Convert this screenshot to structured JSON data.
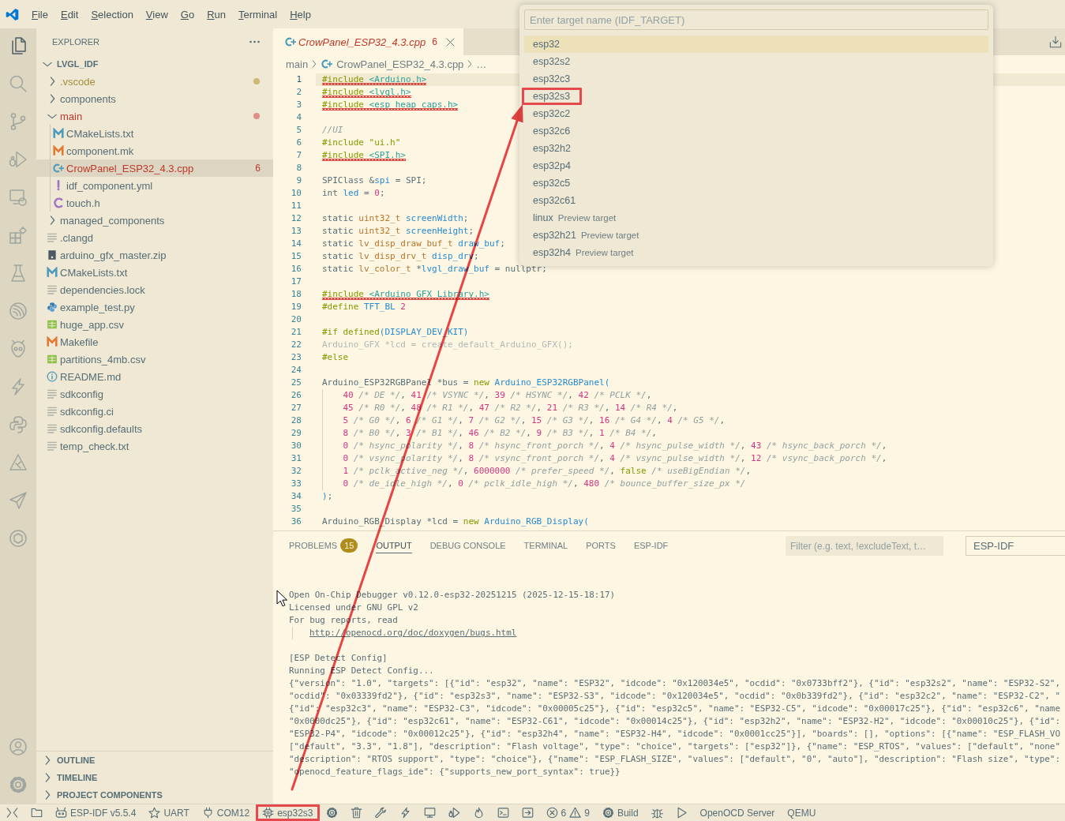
{
  "menu": [
    "File",
    "Edit",
    "Selection",
    "View",
    "Go",
    "Run",
    "Terminal",
    "Help"
  ],
  "quick_pick": {
    "placeholder": "Enter target name (IDF_TARGET)",
    "items": [
      {
        "label": "esp32",
        "selected": true,
        "annotated": false
      },
      {
        "label": "esp32s2",
        "selected": false,
        "annotated": false
      },
      {
        "label": "esp32c3",
        "selected": false,
        "annotated": false
      },
      {
        "label": "esp32s3",
        "selected": false,
        "annotated": true
      },
      {
        "label": "esp32c2",
        "selected": false,
        "annotated": false
      },
      {
        "label": "esp32c6",
        "selected": false,
        "annotated": false
      },
      {
        "label": "esp32h2",
        "selected": false,
        "annotated": false
      },
      {
        "label": "esp32p4",
        "selected": false,
        "annotated": false
      },
      {
        "label": "esp32c5",
        "selected": false,
        "annotated": false
      },
      {
        "label": "esp32c61",
        "selected": false,
        "annotated": false
      },
      {
        "label": "linux",
        "description": "Preview target",
        "selected": false,
        "annotated": false
      },
      {
        "label": "esp32h21",
        "description": "Preview target",
        "selected": false,
        "annotated": false
      },
      {
        "label": "esp32h4",
        "description": "Preview target",
        "selected": false,
        "annotated": false
      }
    ]
  },
  "activity_bar": {
    "top": [
      {
        "kind": "explorer",
        "selected": true
      },
      {
        "kind": "search",
        "selected": false
      },
      {
        "kind": "source-control",
        "selected": false
      },
      {
        "kind": "run-debug",
        "selected": false
      },
      {
        "kind": "remote-explorer",
        "selected": false
      },
      {
        "kind": "extensions",
        "selected": false
      },
      {
        "kind": "testing",
        "selected": false
      },
      {
        "kind": "espressif",
        "selected": false
      },
      {
        "kind": "platformio",
        "selected": false
      },
      {
        "kind": "lightning",
        "selected": false
      },
      {
        "kind": "python",
        "selected": false
      },
      {
        "kind": "triangle-tool",
        "selected": false
      },
      {
        "kind": "send",
        "selected": false
      },
      {
        "kind": "ring",
        "selected": false
      }
    ],
    "bottom": [
      {
        "kind": "accounts"
      },
      {
        "kind": "manage"
      }
    ]
  },
  "sidebar": {
    "title": "EXPLORER",
    "tree": {
      "label": "LVGL_IDF",
      "expanded": true,
      "children": [
        {
          "label": ".vscode",
          "kind": "folder",
          "expanded": false,
          "selected": false,
          "has_errors": false,
          "has_warnings": true
        },
        {
          "label": "components",
          "kind": "folder",
          "expanded": false,
          "selected": false,
          "has_errors": false,
          "has_warnings": false
        },
        {
          "label": "main",
          "kind": "folder",
          "expanded": true,
          "selected": false,
          "has_errors": true,
          "has_warnings": false,
          "children": [
            {
              "label": "CMakeLists.txt",
              "kind": "cmake",
              "selected": false,
              "has_errors": false,
              "has_warnings": false
            },
            {
              "label": "component.mk",
              "kind": "make",
              "selected": false,
              "has_errors": false,
              "has_warnings": false
            },
            {
              "label": "CrowPanel_ESP32_4.3.cpp",
              "kind": "cpp",
              "selected": true,
              "has_errors": true,
              "has_warnings": false,
              "count": "6"
            },
            {
              "label": "idf_component.yml",
              "kind": "yaml",
              "selected": false,
              "has_errors": false,
              "has_warnings": false
            },
            {
              "label": "touch.h",
              "kind": "header",
              "selected": false,
              "has_errors": false,
              "has_warnings": false
            }
          ]
        },
        {
          "label": "managed_components",
          "kind": "folder",
          "expanded": false,
          "selected": false,
          "has_errors": false,
          "has_warnings": false
        },
        {
          "label": ".clangd",
          "kind": "text",
          "selected": false,
          "has_errors": false,
          "has_warnings": false
        },
        {
          "label": "arduino_gfx_master.zip",
          "kind": "zip",
          "selected": false,
          "has_errors": false,
          "has_warnings": false
        },
        {
          "label": "CMakeLists.txt",
          "kind": "cmake",
          "selected": false,
          "has_errors": false,
          "has_warnings": false
        },
        {
          "label": "dependencies.lock",
          "kind": "text",
          "selected": false,
          "has_errors": false,
          "has_warnings": false
        },
        {
          "label": "example_test.py",
          "kind": "python",
          "selected": false,
          "has_errors": false,
          "has_warnings": false
        },
        {
          "label": "huge_app.csv",
          "kind": "csv",
          "selected": false,
          "has_errors": false,
          "has_warnings": false
        },
        {
          "label": "Makefile",
          "kind": "make",
          "selected": false,
          "has_errors": false,
          "has_warnings": false
        },
        {
          "label": "partitions_4mb.csv",
          "kind": "csv",
          "selected": false,
          "has_errors": false,
          "has_warnings": false
        },
        {
          "label": "README.md",
          "kind": "readme",
          "selected": false,
          "has_errors": false,
          "has_warnings": false
        },
        {
          "label": "sdkconfig",
          "kind": "text",
          "selected": false,
          "has_errors": false,
          "has_warnings": false
        },
        {
          "label": "sdkconfig.ci",
          "kind": "text",
          "selected": false,
          "has_errors": false,
          "has_warnings": false
        },
        {
          "label": "sdkconfig.defaults",
          "kind": "text",
          "selected": false,
          "has_errors": false,
          "has_warnings": false
        },
        {
          "label": "temp_check.txt",
          "kind": "text",
          "selected": false,
          "has_errors": false,
          "has_warnings": false
        }
      ]
    },
    "sections": [
      {
        "label": "OUTLINE",
        "expanded": false
      },
      {
        "label": "TIMELINE",
        "expanded": false
      },
      {
        "label": "PROJECT COMPONENTS",
        "expanded": false
      }
    ]
  },
  "editor": {
    "tabs": [
      {
        "label": "CrowPanel_ESP32_4.3.cpp",
        "kind": "cpp",
        "has_errors": true,
        "count": "6",
        "preview": true,
        "selected": true
      }
    ],
    "breadcrumbs": [
      {
        "text": "main",
        "kind": "folder"
      },
      {
        "text": "CrowPanel_ESP32_4.3.cpp",
        "kind": "cpp"
      },
      {
        "text": "…",
        "kind": "symbol"
      }
    ],
    "lines": [
      {
        "number": "1",
        "error": true,
        "current": true,
        "tokens": [
          {
            "kind": "keyword",
            "text": "#include "
          },
          {
            "kind": "path",
            "text": "<Arduino.h>"
          }
        ]
      },
      {
        "number": "2",
        "error": true,
        "current": false,
        "tokens": [
          {
            "kind": "keyword",
            "text": "#include "
          },
          {
            "kind": "path",
            "text": "<lvgl.h>"
          }
        ]
      },
      {
        "number": "3",
        "error": true,
        "current": false,
        "tokens": [
          {
            "kind": "keyword",
            "text": "#include "
          },
          {
            "kind": "path",
            "text": "<esp_heap_caps.h>"
          }
        ]
      },
      {
        "number": "4",
        "error": false,
        "current": false
      },
      {
        "number": "5",
        "error": false,
        "current": false,
        "tokens": [
          {
            "kind": "comment",
            "text": "//UI"
          }
        ]
      },
      {
        "number": "6",
        "error": false,
        "current": false,
        "tokens": [
          {
            "kind": "keyword",
            "text": "#include "
          },
          {
            "kind": "string",
            "text": "\"ui.h\""
          }
        ]
      },
      {
        "number": "7",
        "error": true,
        "current": false,
        "tokens": [
          {
            "kind": "keyword",
            "text": "#include "
          },
          {
            "kind": "path",
            "text": "<SPI.h>"
          }
        ]
      },
      {
        "number": "8",
        "error": false,
        "current": false
      },
      {
        "number": "9",
        "error": false,
        "current": false,
        "tokens": [
          {
            "kind": "plain",
            "text": "SPIClass &"
          },
          {
            "kind": "name",
            "text": "spi"
          },
          {
            "kind": "plain",
            "text": " = SPI;"
          }
        ]
      },
      {
        "number": "10",
        "error": false,
        "current": false,
        "tokens": [
          {
            "kind": "plain",
            "text": "int "
          },
          {
            "kind": "name",
            "text": "led"
          },
          {
            "kind": "plain",
            "text": " = "
          },
          {
            "kind": "number",
            "text": "0"
          },
          {
            "kind": "plain",
            "text": ";"
          }
        ]
      },
      {
        "number": "11",
        "error": false,
        "current": false
      },
      {
        "number": "12",
        "error": false,
        "current": false,
        "tokens": [
          {
            "kind": "plain",
            "text": "static "
          },
          {
            "kind": "type",
            "text": "uint32_t "
          },
          {
            "kind": "name",
            "text": "screenWidth"
          },
          {
            "kind": "plain",
            "text": ";"
          }
        ]
      },
      {
        "number": "13",
        "error": false,
        "current": false,
        "tokens": [
          {
            "kind": "plain",
            "text": "static "
          },
          {
            "kind": "type",
            "text": "uint32_t "
          },
          {
            "kind": "name",
            "text": "screenHeight"
          },
          {
            "kind": "plain",
            "text": ";"
          }
        ]
      },
      {
        "number": "14",
        "error": false,
        "current": false,
        "tokens": [
          {
            "kind": "plain",
            "text": "static "
          },
          {
            "kind": "type",
            "text": "lv_disp_draw_buf_t "
          },
          {
            "kind": "name",
            "text": "draw_buf"
          },
          {
            "kind": "plain",
            "text": ";"
          }
        ]
      },
      {
        "number": "15",
        "error": false,
        "current": false,
        "tokens": [
          {
            "kind": "plain",
            "text": "static "
          },
          {
            "kind": "type",
            "text": "lv_disp_drv_t "
          },
          {
            "kind": "name",
            "text": "disp_drv"
          },
          {
            "kind": "plain",
            "text": ";"
          }
        ]
      },
      {
        "number": "16",
        "error": false,
        "current": false,
        "tokens": [
          {
            "kind": "plain",
            "text": "static "
          },
          {
            "kind": "type",
            "text": "lv_color_t "
          },
          {
            "kind": "plain",
            "text": "*"
          },
          {
            "kind": "name",
            "text": "lvgl_draw_buf"
          },
          {
            "kind": "plain",
            "text": " = nullptr;"
          }
        ]
      },
      {
        "number": "17",
        "error": false,
        "current": false
      },
      {
        "number": "18",
        "error": true,
        "current": false,
        "tokens": [
          {
            "kind": "keyword",
            "text": "#include "
          },
          {
            "kind": "path",
            "text": "<Arduino_GFX_Library.h>"
          }
        ]
      },
      {
        "number": "19",
        "error": false,
        "current": false,
        "tokens": [
          {
            "kind": "keyword",
            "text": "#define "
          },
          {
            "kind": "name",
            "text": "TFT_BL "
          },
          {
            "kind": "number",
            "text": "2"
          }
        ]
      },
      {
        "number": "20",
        "error": false,
        "current": false
      },
      {
        "number": "21",
        "error": false,
        "current": false,
        "tokens": [
          {
            "kind": "keyword",
            "text": "#if defined"
          },
          {
            "kind": "name",
            "text": "(DISPLAY_DEV_KIT)"
          }
        ]
      },
      {
        "number": "22",
        "error": false,
        "current": false,
        "tokens": [
          {
            "kind": "inactive",
            "text": "Arduino_GFX *lcd = create_default_Arduino_GFX();"
          }
        ]
      },
      {
        "number": "23",
        "error": false,
        "current": false,
        "tokens": [
          {
            "kind": "keyword",
            "text": "#else"
          }
        ]
      },
      {
        "number": "24",
        "error": false,
        "current": false
      },
      {
        "number": "25",
        "error": false,
        "current": false,
        "tokens": [
          {
            "kind": "plain",
            "text": "Arduino_ESP32RGBPanel *bus = "
          },
          {
            "kind": "keyword",
            "text": "new "
          },
          {
            "kind": "name",
            "text": "Arduino_ESP32RGBPanel("
          }
        ],
        "children": [
          {
            "number": "26",
            "error": false,
            "current": false,
            "tokens": [
              {
                "kind": "number",
                "text": "40"
              },
              {
                "kind": "comment",
                "text": " /* DE */"
              },
              {
                "kind": "plain",
                "text": ", "
              },
              {
                "kind": "number",
                "text": "41"
              },
              {
                "kind": "comment",
                "text": " /* VSYNC */"
              },
              {
                "kind": "plain",
                "text": ", "
              },
              {
                "kind": "number",
                "text": "39"
              },
              {
                "kind": "comment",
                "text": " /* HSYNC */"
              },
              {
                "kind": "plain",
                "text": ", "
              },
              {
                "kind": "number",
                "text": "42"
              },
              {
                "kind": "comment",
                "text": " /* PCLK */"
              },
              {
                "kind": "plain",
                "text": ","
              }
            ]
          },
          {
            "number": "27",
            "error": false,
            "current": false,
            "tokens": [
              {
                "kind": "number",
                "text": "45"
              },
              {
                "kind": "comment",
                "text": " /* R0 */"
              },
              {
                "kind": "plain",
                "text": ", "
              },
              {
                "kind": "number",
                "text": "48"
              },
              {
                "kind": "comment",
                "text": " /* R1 */"
              },
              {
                "kind": "plain",
                "text": ", "
              },
              {
                "kind": "number",
                "text": "47"
              },
              {
                "kind": "comment",
                "text": " /* R2 */"
              },
              {
                "kind": "plain",
                "text": ", "
              },
              {
                "kind": "number",
                "text": "21"
              },
              {
                "kind": "comment",
                "text": " /* R3 */"
              },
              {
                "kind": "plain",
                "text": ", "
              },
              {
                "kind": "number",
                "text": "14"
              },
              {
                "kind": "comment",
                "text": " /* R4 */"
              },
              {
                "kind": "plain",
                "text": ","
              }
            ]
          },
          {
            "number": "28",
            "error": false,
            "current": false,
            "tokens": [
              {
                "kind": "number",
                "text": "5"
              },
              {
                "kind": "comment",
                "text": " /* G0 */"
              },
              {
                "kind": "plain",
                "text": ", "
              },
              {
                "kind": "number",
                "text": "6"
              },
              {
                "kind": "comment",
                "text": " /* G1 */"
              },
              {
                "kind": "plain",
                "text": ", "
              },
              {
                "kind": "number",
                "text": "7"
              },
              {
                "kind": "comment",
                "text": " /* G2 */"
              },
              {
                "kind": "plain",
                "text": ", "
              },
              {
                "kind": "number",
                "text": "15"
              },
              {
                "kind": "comment",
                "text": " /* G3 */"
              },
              {
                "kind": "plain",
                "text": ", "
              },
              {
                "kind": "number",
                "text": "16"
              },
              {
                "kind": "comment",
                "text": " /* G4 */"
              },
              {
                "kind": "plain",
                "text": ", "
              },
              {
                "kind": "number",
                "text": "4"
              },
              {
                "kind": "comment",
                "text": " /* G5 */"
              },
              {
                "kind": "plain",
                "text": ","
              }
            ]
          },
          {
            "number": "29",
            "error": false,
            "current": false,
            "tokens": [
              {
                "kind": "number",
                "text": "8"
              },
              {
                "kind": "comment",
                "text": " /* B0 */"
              },
              {
                "kind": "plain",
                "text": ", "
              },
              {
                "kind": "number",
                "text": "3"
              },
              {
                "kind": "comment",
                "text": " /* B1 */"
              },
              {
                "kind": "plain",
                "text": ", "
              },
              {
                "kind": "number",
                "text": "46"
              },
              {
                "kind": "comment",
                "text": " /* B2 */"
              },
              {
                "kind": "plain",
                "text": ", "
              },
              {
                "kind": "number",
                "text": "9"
              },
              {
                "kind": "comment",
                "text": " /* B3 */"
              },
              {
                "kind": "plain",
                "text": ", "
              },
              {
                "kind": "number",
                "text": "1"
              },
              {
                "kind": "comment",
                "text": " /* B4 */"
              },
              {
                "kind": "plain",
                "text": ","
              }
            ]
          },
          {
            "number": "30",
            "error": false,
            "current": false,
            "tokens": [
              {
                "kind": "number",
                "text": "0"
              },
              {
                "kind": "comment",
                "text": " /* hsync_polarity */"
              },
              {
                "kind": "plain",
                "text": ", "
              },
              {
                "kind": "number",
                "text": "8"
              },
              {
                "kind": "comment",
                "text": " /* hsync_front_porch */"
              },
              {
                "kind": "plain",
                "text": ", "
              },
              {
                "kind": "number",
                "text": "4"
              },
              {
                "kind": "comment",
                "text": " /* hsync_pulse_width */"
              },
              {
                "kind": "plain",
                "text": ", "
              },
              {
                "kind": "number",
                "text": "43"
              },
              {
                "kind": "comment",
                "text": " /* hsync_back_porch */"
              },
              {
                "kind": "plain",
                "text": ","
              }
            ]
          },
          {
            "number": "31",
            "error": false,
            "current": false,
            "tokens": [
              {
                "kind": "number",
                "text": "0"
              },
              {
                "kind": "comment",
                "text": " /* vsync_polarity */"
              },
              {
                "kind": "plain",
                "text": ", "
              },
              {
                "kind": "number",
                "text": "8"
              },
              {
                "kind": "comment",
                "text": " /* vsync_front_porch */"
              },
              {
                "kind": "plain",
                "text": ", "
              },
              {
                "kind": "number",
                "text": "4"
              },
              {
                "kind": "comment",
                "text": " /* vsync_pulse_width */"
              },
              {
                "kind": "plain",
                "text": ", "
              },
              {
                "kind": "number",
                "text": "12"
              },
              {
                "kind": "comment",
                "text": " /* vsync_back_porch */"
              },
              {
                "kind": "plain",
                "text": ","
              }
            ]
          },
          {
            "number": "32",
            "error": false,
            "current": false,
            "tokens": [
              {
                "kind": "number",
                "text": "1"
              },
              {
                "kind": "comment",
                "text": " /* pclk_active_neg */"
              },
              {
                "kind": "plain",
                "text": ", "
              },
              {
                "kind": "number",
                "text": "6000000"
              },
              {
                "kind": "comment",
                "text": " /* prefer_speed */"
              },
              {
                "kind": "plain",
                "text": ", "
              },
              {
                "kind": "keyword",
                "text": "false"
              },
              {
                "kind": "comment",
                "text": " /* useBigEndian */"
              },
              {
                "kind": "plain",
                "text": ","
              }
            ]
          },
          {
            "number": "33",
            "error": false,
            "current": false,
            "tokens": [
              {
                "kind": "number",
                "text": "0"
              },
              {
                "kind": "comment",
                "text": " /* de_idle_high */"
              },
              {
                "kind": "plain",
                "text": ", "
              },
              {
                "kind": "number",
                "text": "0"
              },
              {
                "kind": "comment",
                "text": " /* pclk_idle_high */"
              },
              {
                "kind": "plain",
                "text": ", "
              },
              {
                "kind": "number",
                "text": "480"
              },
              {
                "kind": "comment",
                "text": " /* bounce_buffer_size_px */"
              }
            ]
          }
        ]
      },
      {
        "number": "34",
        "error": false,
        "current": false,
        "tokens": [
          {
            "kind": "name",
            "text": ")"
          },
          {
            "kind": "plain",
            "text": ";"
          }
        ]
      },
      {
        "number": "35",
        "error": false,
        "current": false
      },
      {
        "number": "36",
        "error": false,
        "current": false,
        "tokens": [
          {
            "kind": "plain",
            "text": "Arduino_RGB_Display *lcd = "
          },
          {
            "kind": "keyword",
            "text": "new "
          },
          {
            "kind": "name",
            "text": "Arduino_RGB_Display("
          }
        ]
      }
    ]
  },
  "panel": {
    "tabs": [
      {
        "label": "PROBLEMS",
        "badge": "15",
        "selected": false
      },
      {
        "label": "OUTPUT",
        "selected": true
      },
      {
        "label": "DEBUG CONSOLE",
        "selected": false
      },
      {
        "label": "TERMINAL",
        "selected": false
      },
      {
        "label": "PORTS",
        "selected": false
      },
      {
        "label": "ESP-IDF",
        "selected": false
      }
    ],
    "filter": {
      "placeholder": "Filter (e.g. text, !excludeText, t…"
    },
    "channel": {
      "value": "ESP-IDF"
    },
    "output": {
      "blocks": [
        {
          "lines": [
            {
              "kind": "text",
              "text": "Open On-Chip Debugger v0.12.0-esp32-20251215 (2025-12-15-18:17)"
            },
            {
              "kind": "text",
              "text": "Licensed under GNU GPL v2"
            },
            {
              "kind": "text",
              "text": "For bug reports, read",
              "children": [
                {
                  "kind": "link",
                  "text": "http://openocd.org/doc/doxygen/bugs.html"
                }
              ]
            }
          ]
        },
        {
          "lines": [
            {
              "kind": "text",
              "text": "[ESP Detect Config]"
            },
            {
              "kind": "text",
              "text": "Running ESP Detect Config..."
            },
            {
              "kind": "text",
              "text": "{\"version\": \"1.0\", \"targets\": [{\"id\": \"esp32\", \"name\": \"ESP32\", \"idcode\": \"0x120034e5\", \"ocdid\": \"0x0733bff2\"}, {\"id\": \"esp32s2\", \"name\": \"ESP32-S2\","
            },
            {
              "kind": "text",
              "text": "\"ocdid\": \"0x03339fd2\"}, {\"id\": \"esp32s3\", \"name\": \"ESP32-S3\", \"idcode\": \"0x120034e5\", \"ocdid\": \"0x0b339fd2\"}, {\"id\": \"esp32c2\", \"name\": \"ESP32-C2\", \""
            },
            {
              "kind": "text",
              "text": "{\"id\": \"esp32c3\", \"name\": \"ESP32-C3\", \"idcode\": \"0x00005c25\"}, {\"id\": \"esp32c5\", \"name\": \"ESP32-C5\", \"idcode\": \"0x00017c25\"}, {\"id\": \"esp32c6\", \"name"
            },
            {
              "kind": "text",
              "text": "\"0x0000dc25\"}, {\"id\": \"esp32c61\", \"name\": \"ESP32-C61\", \"idcode\": \"0x00014c25\"}, {\"id\": \"esp32h2\", \"name\": \"ESP32-H2\", \"idcode\": \"0x00010c25\"}, {\"id\":"
            },
            {
              "kind": "text",
              "text": "\"ESP32-P4\", \"idcode\": \"0x00012c25\"}, {\"id\": \"esp32h4\", \"name\": \"ESP32-H4\", \"idcode\": \"0x0001cc25\"}], \"boards\": [], \"options\": [{\"name\": \"ESP_FLASH_VO"
            },
            {
              "kind": "text",
              "text": "[\"default\", \"3.3\", \"1.8\"], \"description\": \"Flash voltage\", \"type\": \"choice\", \"targets\": [\"esp32\"]}, {\"name\": \"ESP_RTOS\", \"values\": [\"default\", \"none\""
            },
            {
              "kind": "text",
              "text": "\"description\": \"RTOS support\", \"type\": \"choice\"}, {\"name\": \"ESP_FLASH_SIZE\", \"values\": [\"default\", \"0\", \"auto\"], \"description\": \"Flash size\", \"type\":"
            },
            {
              "kind": "text",
              "text": "\"openocd_feature_flags_ide\": {\"supports_new_port_syntax\": true}}"
            }
          ]
        }
      ]
    }
  },
  "status_bar": {
    "items": [
      {
        "kind": "remote",
        "annotated": false
      },
      {
        "kind": "folder",
        "annotated": false
      },
      {
        "kind": "idf-version",
        "text": "ESP-IDF v5.5.4",
        "annotated": false
      },
      {
        "kind": "port-type",
        "text": "UART",
        "annotated": false
      },
      {
        "kind": "port",
        "text": "COM12",
        "annotated": false
      },
      {
        "kind": "target",
        "text": "esp32s3",
        "annotated": true
      },
      {
        "kind": "settings",
        "annotated": false
      },
      {
        "kind": "clean",
        "annotated": false
      },
      {
        "kind": "configure",
        "annotated": false
      },
      {
        "kind": "flash",
        "annotated": false
      },
      {
        "kind": "monitor",
        "annotated": false
      },
      {
        "kind": "debug-launch",
        "annotated": false
      },
      {
        "kind": "flame",
        "annotated": false
      },
      {
        "kind": "terminal",
        "annotated": false
      },
      {
        "kind": "extension",
        "annotated": false
      },
      {
        "kind": "problems",
        "errors": "6",
        "warnings": "9",
        "annotated": false
      },
      {
        "kind": "build",
        "text": "Build",
        "annotated": false
      },
      {
        "kind": "debug",
        "annotated": false
      },
      {
        "kind": "run",
        "annotated": false
      },
      {
        "kind": "openocd",
        "text": "OpenOCD Server",
        "annotated": false
      },
      {
        "kind": "qemu",
        "text": "QEMU",
        "annotated": false
      }
    ]
  }
}
